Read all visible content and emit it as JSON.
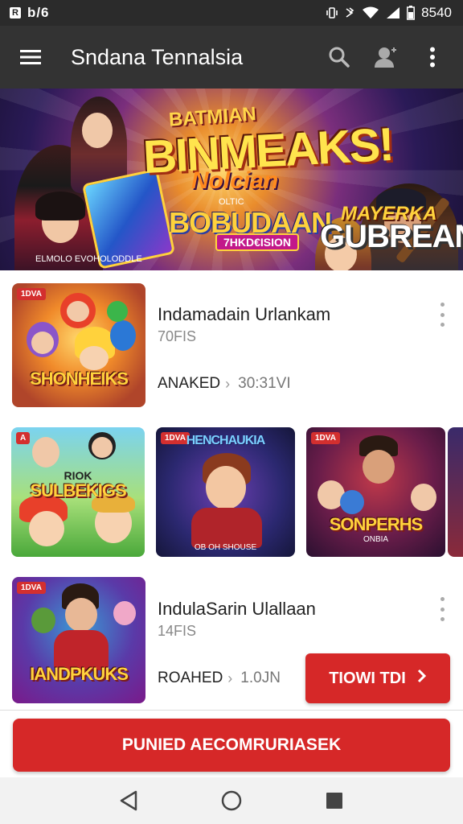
{
  "status_bar": {
    "badge": "R",
    "left_text": "b/6",
    "time": "8540",
    "colors": {
      "background": "#2b2b2b"
    }
  },
  "app_bar": {
    "title": "Sndana Tennalsia",
    "icons": [
      "menu-icon",
      "search-icon",
      "account-icon",
      "more-vert-icon"
    ]
  },
  "banner": {
    "line1": "BATMIAN",
    "line2": "BINMEAKS!",
    "line3": "Nolcian",
    "line4": "OLTIC",
    "line5": "BOBUDAAN",
    "line6": "7HKD€ISION",
    "line7": "MAYERKA",
    "line8": "GUBREAN",
    "line9": "ELMOLO EVOHOLODDLE"
  },
  "cards": [
    {
      "thumb_tag": "1DVA",
      "thumb_title": "SHONHEIKS",
      "title": "Indamadain Urlankam",
      "subtitle": "70FIS",
      "meta_label": "ANAKED",
      "meta_value": "30:31VI"
    },
    {
      "thumb_tag": "1DVA",
      "thumb_title": "IANDPKUKS",
      "title": "IndulaSarin Ulallaan",
      "subtitle": "14FIS",
      "meta_label": "ROAHED",
      "meta_value": "1.0JN"
    }
  ],
  "carousel": [
    {
      "tag": "A",
      "title": "SULBEKIGS",
      "subtitle": "RIOK"
    },
    {
      "tag": "1DVA",
      "title": "HENCHAUKIA",
      "subtitle": "OB OH SHOUSE"
    },
    {
      "tag": "1DVA",
      "title": "SONPERHS",
      "subtitle": "ONBIA"
    }
  ],
  "red_button": {
    "label": "TIOWI TDI",
    "icon": "chevron-right-icon"
  },
  "cta": {
    "label": "PUNIED AECOMRURIASEK"
  },
  "nav": {
    "icons": [
      "back-icon",
      "home-icon",
      "recents-icon"
    ]
  },
  "accent_colors": {
    "primary": "#d62828",
    "appbar": "#333333"
  }
}
